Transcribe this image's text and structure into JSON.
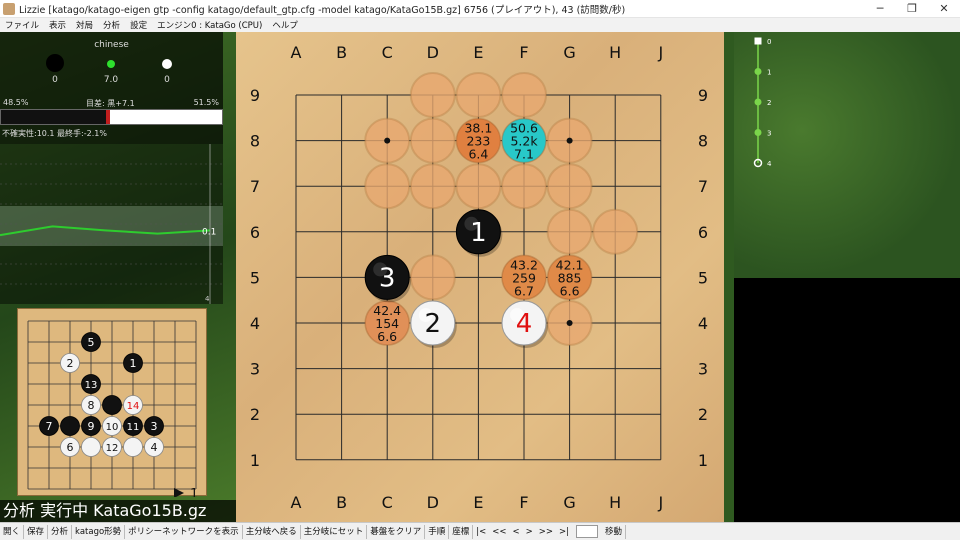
{
  "window": {
    "title": "Lizzie [katago/katago-eigen gtp -config katago/default_gtp.cfg -model katago/KataGo15B.gz] 6756 (プレイアウト), 43 (訪問数/秒)",
    "minimize": "─",
    "maximize": "❐",
    "close": "✕"
  },
  "menu": [
    "ファイル",
    "表示",
    "対局",
    "分析",
    "設定",
    "エンジン0 : KataGo (CPU)",
    "ヘルプ"
  ],
  "stats": {
    "rules": "chinese",
    "captures": {
      "black": "0",
      "komi": "7.0",
      "white": "0"
    },
    "black_winrate": "48.5%",
    "score_label": "目差: 黒+7.1",
    "white_winrate": "51.5%",
    "black_fraction": 0.485,
    "uncertainty": "不確実性:10.1 最終手:-2.1%"
  },
  "graph": {
    "points": [
      0.43,
      0.485,
      0.46,
      0.44,
      0.46
    ],
    "last_label": "0.1",
    "move_label": "4",
    "line_color": "#2ecc2e"
  },
  "status_overlay": "分析 実行中 KataGo15B.gz",
  "board": {
    "columns": [
      "A",
      "B",
      "C",
      "D",
      "E",
      "F",
      "G",
      "H",
      "J"
    ],
    "rows": [
      "9",
      "8",
      "7",
      "6",
      "5",
      "4",
      "3",
      "2",
      "1"
    ],
    "stones": [
      {
        "col": 4,
        "row": 5,
        "color": "black",
        "label": "1"
      },
      {
        "col": 3,
        "row": 3,
        "color": "white",
        "label": "2"
      },
      {
        "col": 2,
        "row": 4,
        "color": "black",
        "label": "3"
      },
      {
        "col": 5,
        "row": 3,
        "color": "white",
        "label": "4",
        "last": true
      }
    ],
    "stars": [
      {
        "col": 2,
        "row": 7
      },
      {
        "col": 6,
        "row": 7
      },
      {
        "col": 2,
        "row": 3
      },
      {
        "col": 6,
        "row": 3
      }
    ],
    "candidates": [
      {
        "col": 4,
        "row": 7,
        "color": "#e08040",
        "lines": [
          "38.1",
          "233",
          "6.4"
        ]
      },
      {
        "col": 5,
        "row": 7,
        "color": "#28c8c8",
        "lines": [
          "50.6",
          "5.2k",
          "7.1"
        ]
      },
      {
        "col": 5,
        "row": 4,
        "color": "#e08a48",
        "lines": [
          "43.2",
          "259",
          "6.7"
        ]
      },
      {
        "col": 6,
        "row": 4,
        "color": "#e08a48",
        "lines": [
          "42.1",
          "885",
          "6.6"
        ]
      },
      {
        "col": 2,
        "row": 3,
        "color": "#e09058",
        "lines": [
          "42.4",
          "154",
          "6.6"
        ]
      }
    ],
    "faint": [
      {
        "col": 3,
        "row": 8
      },
      {
        "col": 4,
        "row": 8
      },
      {
        "col": 5,
        "row": 8
      },
      {
        "col": 2,
        "row": 7
      },
      {
        "col": 3,
        "row": 7
      },
      {
        "col": 6,
        "row": 7
      },
      {
        "col": 2,
        "row": 6
      },
      {
        "col": 3,
        "row": 6
      },
      {
        "col": 4,
        "row": 6
      },
      {
        "col": 5,
        "row": 6
      },
      {
        "col": 6,
        "row": 6
      },
      {
        "col": 6,
        "row": 5
      },
      {
        "col": 7,
        "row": 5
      },
      {
        "col": 3,
        "row": 4
      },
      {
        "col": 6,
        "row": 3
      }
    ]
  },
  "mini_board": {
    "move_indicator": "1",
    "stones": [
      {
        "col": 3,
        "row": 7,
        "color": "black",
        "label": "5"
      },
      {
        "col": 2,
        "row": 6,
        "color": "white",
        "label": "2"
      },
      {
        "col": 5,
        "row": 6,
        "color": "black",
        "label": "1"
      },
      {
        "col": 3,
        "row": 5,
        "color": "black",
        "label": "13"
      },
      {
        "col": 3,
        "row": 4,
        "color": "white",
        "label": "8"
      },
      {
        "col": 4,
        "row": 4,
        "color": "black",
        "label": ""
      },
      {
        "col": 5,
        "row": 4,
        "color": "white",
        "label": "14",
        "red": true
      },
      {
        "col": 1,
        "row": 3,
        "color": "black",
        "label": "7"
      },
      {
        "col": 2,
        "row": 3,
        "color": "black",
        "label": ""
      },
      {
        "col": 3,
        "row": 3,
        "color": "black",
        "label": "9"
      },
      {
        "col": 4,
        "row": 3,
        "color": "white",
        "label": "10"
      },
      {
        "col": 5,
        "row": 3,
        "color": "black",
        "label": "11"
      },
      {
        "col": 6,
        "row": 3,
        "color": "black",
        "label": "3"
      },
      {
        "col": 2,
        "row": 2,
        "color": "white",
        "label": "6"
      },
      {
        "col": 3,
        "row": 2,
        "color": "white",
        "label": ""
      },
      {
        "col": 4,
        "row": 2,
        "color": "white",
        "label": "12"
      },
      {
        "col": 5,
        "row": 2,
        "color": "white",
        "label": ""
      },
      {
        "col": 6,
        "row": 2,
        "color": "white",
        "label": "4"
      }
    ]
  },
  "variation_tree": {
    "nodes": [
      "0",
      "1",
      "2",
      "3",
      "4"
    ]
  },
  "toolbar": {
    "buttons": [
      "開く",
      "保存",
      "分析",
      "katago形勢",
      "ポリシーネットワークを表示",
      "主分岐へ戻る",
      "主分岐にセット",
      "碁盤をクリア",
      "手順",
      "座標"
    ],
    "nav": [
      "|<",
      "<<",
      "<",
      ">",
      ">>",
      ">|"
    ],
    "move_input": "",
    "go_button": "移動"
  }
}
